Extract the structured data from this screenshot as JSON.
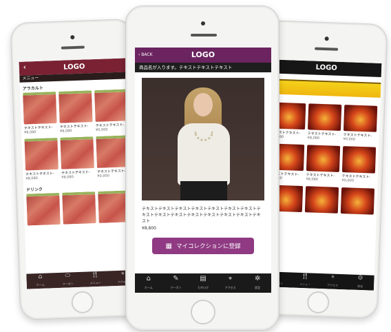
{
  "left_phone": {
    "nav": {
      "back": "‹",
      "logo": "LOGO"
    },
    "menu_label": "メニュー",
    "section1": "アラカルト",
    "section2": "ドリンク",
    "items": [
      {
        "name": "テキストテキスト-",
        "price": "¥8,080"
      },
      {
        "name": "テキストテキスト-",
        "price": "¥8,080"
      },
      {
        "name": "テキストテキスト-",
        "price": "¥0,000"
      },
      {
        "name": "テキストテキスト-",
        "price": "¥8,080"
      },
      {
        "name": "テキストテキスト-",
        "price": "¥8,080"
      },
      {
        "name": "テキストテキスト-",
        "price": "¥0,000"
      }
    ],
    "tabs": [
      {
        "icon": "⌂",
        "label": "ホーム"
      },
      {
        "icon": "⬭",
        "label": "クーポン"
      },
      {
        "icon": "🍴",
        "label": "メニュー"
      },
      {
        "icon": "⌖",
        "label": "アクセス"
      }
    ]
  },
  "center_phone": {
    "nav": {
      "back": "‹ BACK",
      "logo": "LOGO"
    },
    "product_title": "商品名が入ります。テキストテキストテキスト",
    "description": "テキストテキストテキストテキストテキストテキストテキストテキストテキストテキストテキストテキストテキストテキストテキスト",
    "price": "¥8,800",
    "collection_button": "マイコレクションに登録",
    "tabs": [
      {
        "icon": "⌂",
        "label": "ホーム"
      },
      {
        "icon": "✎",
        "label": "クーポン"
      },
      {
        "icon": "▤",
        "label": "カタログ"
      },
      {
        "icon": "⌖",
        "label": "アクセス"
      },
      {
        "icon": "✲",
        "label": "設定"
      }
    ]
  },
  "right_phone": {
    "nav": {
      "logo": "LOGO"
    },
    "section1": "ー",
    "items": [
      {
        "name": "テキストテキスト-",
        "price": "¥8,080"
      },
      {
        "name": "テキストテキスト-",
        "price": "¥8,080"
      },
      {
        "name": "テキストテキスト-",
        "price": "¥0,000"
      },
      {
        "name": "テキストテキスト-",
        "price": "¥8,080"
      },
      {
        "name": "テキストテキスト-",
        "price": "¥8,080"
      },
      {
        "name": "テキストテキスト-",
        "price": "¥0,000"
      }
    ],
    "tabs": [
      {
        "icon": "✎",
        "label": "クーポン"
      },
      {
        "icon": "🍴",
        "label": "メニュー"
      },
      {
        "icon": "⌖",
        "label": "アクセス"
      },
      {
        "icon": "⚙",
        "label": "設定"
      }
    ]
  },
  "colors": {
    "left_accent": "#7a2234",
    "center_accent": "#6b2460",
    "button": "#8f3a82",
    "right_accent": "#f4d21a"
  }
}
